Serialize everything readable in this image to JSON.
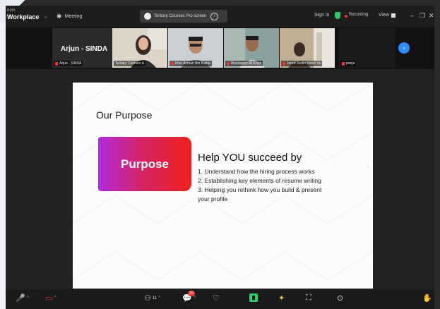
{
  "app": {
    "line1": "oom",
    "line2": "Workplace"
  },
  "meeting": {
    "label": "Meeting"
  },
  "topic": {
    "text": "Tertiary Courses Pro screen"
  },
  "topbar": {
    "signin": "Sign in",
    "recording": "Recording",
    "view": "View"
  },
  "participants": {
    "highlight_name": "Arjun - SINDA",
    "tiles": [
      {
        "label": "Arjun - SINDA"
      },
      {
        "label": "Tertiary Courses &"
      },
      {
        "label": "Irfan Azman Bin Kama"
      },
      {
        "label": "Mustaqeer Ali Khan"
      },
      {
        "label": "Jared Justin Sidek Va"
      },
      {
        "label": "pooja"
      }
    ]
  },
  "slide": {
    "title": "Our Purpose",
    "box_label": "Purpose",
    "help_title": "Help YOU succeed by",
    "items": [
      "1.  Understand how the hiring process works",
      "2.  Establishing key elements of resume writing",
      "3.  Helping you rethink how you build & present",
      "     your profile"
    ]
  },
  "toolbar": {
    "participants_count": "11",
    "chat_badge": "20"
  },
  "colors": {
    "accent": "#2d8cff",
    "active_speaker": "#2ecc71",
    "purpose_start": "#b22adb",
    "purpose_end": "#f0211e"
  }
}
